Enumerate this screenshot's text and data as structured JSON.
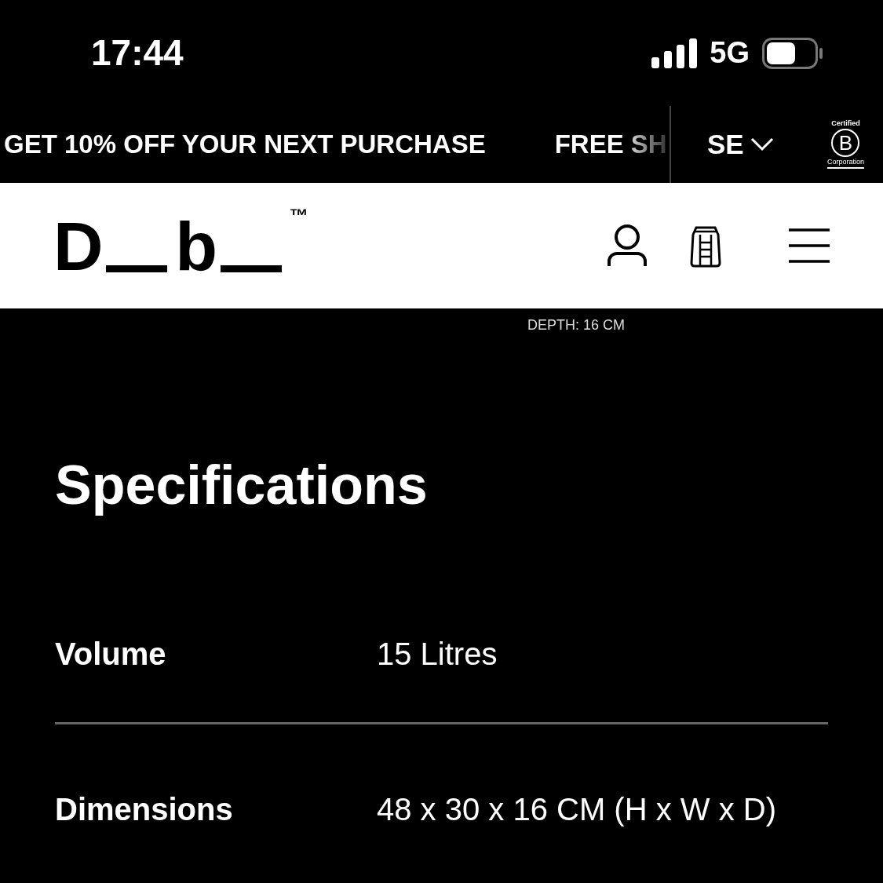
{
  "status_bar": {
    "time": "17:44",
    "network": "5G"
  },
  "promo_bar": {
    "messages": [
      "GET 10% OFF YOUR NEXT PURCHASE",
      "FREE SH"
    ],
    "region": "SE",
    "badge_top": "Certified",
    "badge_letter": "B",
    "badge_bottom": "Corporation"
  },
  "header": {
    "logo": {
      "letters": [
        "D",
        "b"
      ],
      "mark": "™"
    }
  },
  "image_caption": "DEPTH: 16 CM",
  "specifications": {
    "title": "Specifications",
    "rows": [
      {
        "label": "Volume",
        "value": "15 Litres"
      },
      {
        "label": "Dimensions",
        "value": "48 x 30 x 16 CM (H x W x D)"
      }
    ]
  }
}
